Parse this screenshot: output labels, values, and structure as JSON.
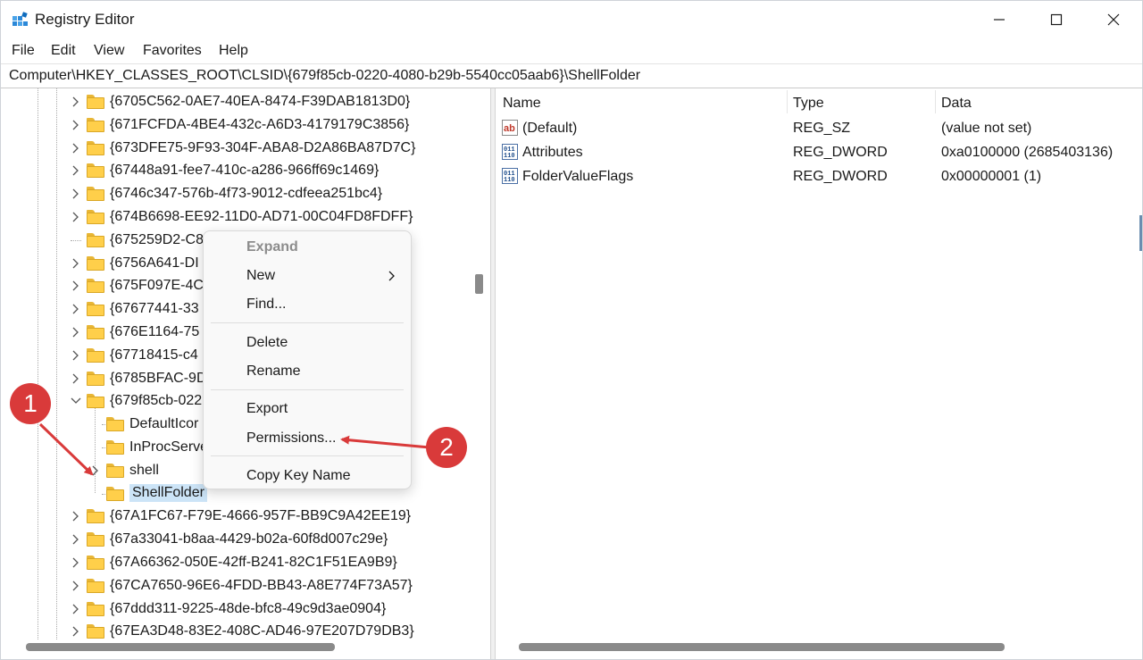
{
  "window": {
    "title": "Registry Editor",
    "accent": "#0f6cbd"
  },
  "menu": [
    "File",
    "Edit",
    "View",
    "Favorites",
    "Help"
  ],
  "address": "Computer\\HKEY_CLASSES_ROOT\\CLSID\\{679f85cb-0220-4080-b29b-5540cc05aab6}\\ShellFolder",
  "tree": [
    {
      "label": "{6705C562-0AE7-40EA-8474-F39DAB1813D0}",
      "expander": "collapsed"
    },
    {
      "label": "{671FCFDA-4BE4-432c-A6D3-4179179C3856}",
      "expander": "collapsed"
    },
    {
      "label": "{673DFE75-9F93-304F-ABA8-D2A86BA87D7C}",
      "expander": "collapsed"
    },
    {
      "label": "{67448a91-fee7-410c-a286-966ff69c1469}",
      "expander": "collapsed"
    },
    {
      "label": "{6746c347-576b-4f73-9012-cdfeea251bc4}",
      "expander": "collapsed"
    },
    {
      "label": "{674B6698-EE92-11D0-AD71-00C04FD8FDFF}",
      "expander": "collapsed"
    },
    {
      "label": "{675259D2-C8",
      "expander": "none"
    },
    {
      "label": "{6756A641-DI",
      "expander": "collapsed"
    },
    {
      "label": "{675F097E-4C",
      "expander": "collapsed"
    },
    {
      "label": "{67677441-33",
      "expander": "collapsed"
    },
    {
      "label": "{676E1164-75",
      "expander": "collapsed"
    },
    {
      "label": "{67718415-c4",
      "expander": "collapsed"
    },
    {
      "label": "{6785BFAC-9D",
      "expander": "collapsed"
    },
    {
      "label": "{679f85cb-022",
      "expander": "expanded"
    },
    {
      "label": "DefaultIcor",
      "expander": "none",
      "child": true
    },
    {
      "label": "InProcServe",
      "expander": "none",
      "child": true
    },
    {
      "label": "shell",
      "expander": "collapsed",
      "child": true
    },
    {
      "label": "ShellFolder",
      "expander": "none",
      "child": true,
      "selected": true
    },
    {
      "label": "{67A1FC67-F79E-4666-957F-BB9C9A42EE19}",
      "expander": "collapsed"
    },
    {
      "label": "{67a33041-b8aa-4429-b02a-60f8d007c29e}",
      "expander": "collapsed"
    },
    {
      "label": "{67A66362-050E-42ff-B241-82C1F51EA9B9}",
      "expander": "collapsed"
    },
    {
      "label": "{67CA7650-96E6-4FDD-BB43-A8E774F73A57}",
      "expander": "collapsed"
    },
    {
      "label": "{67ddd311-9225-48de-bfc8-49c9d3ae0904}",
      "expander": "collapsed"
    },
    {
      "label": "{67EA3D48-83E2-408C-AD46-97E207D79DB3}",
      "expander": "collapsed"
    }
  ],
  "values_header": {
    "name": "Name",
    "type": "Type",
    "data": "Data"
  },
  "values": [
    {
      "name": "(Default)",
      "type": "REG_SZ",
      "data": "(value not set)",
      "icon": "string-value-icon"
    },
    {
      "name": "Attributes",
      "type": "REG_DWORD",
      "data": "0xa0100000 (2685403136)",
      "icon": "binary-value-icon"
    },
    {
      "name": "FolderValueFlags",
      "type": "REG_DWORD",
      "data": "0x00000001 (1)",
      "icon": "binary-value-icon"
    }
  ],
  "context_menu": {
    "expand": "Expand",
    "new": "New",
    "find": "Find...",
    "delete": "Delete",
    "rename": "Rename",
    "export": "Export",
    "permissions": "Permissions...",
    "copy_key_name": "Copy Key Name"
  },
  "annotations": {
    "badge1": "1",
    "badge2": "2",
    "color": "#d93a3a"
  }
}
